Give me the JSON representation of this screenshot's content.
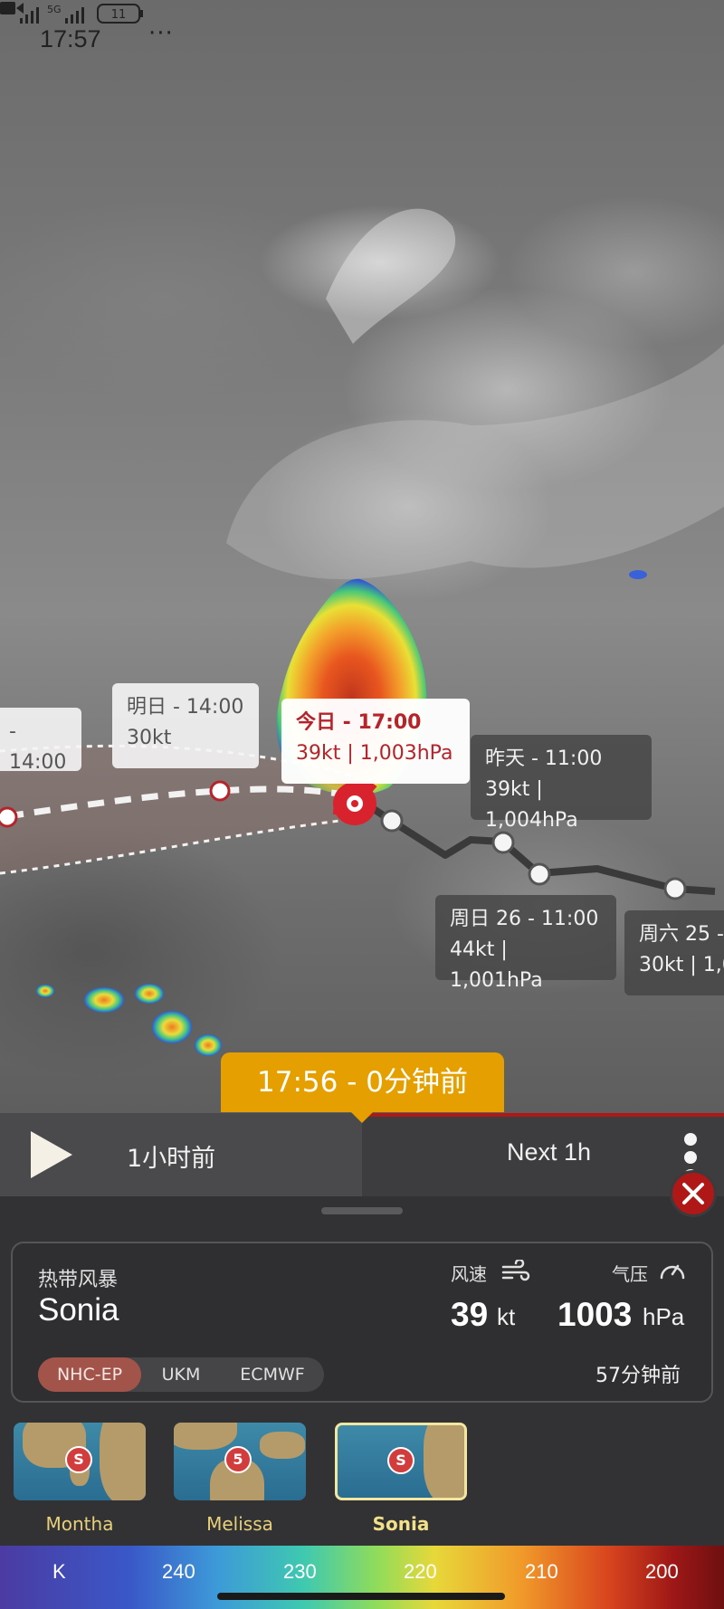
{
  "status_bar": {
    "time": "17:57",
    "dots": "···",
    "battery": "11",
    "network_1": "5G",
    "network_2": "5G"
  },
  "map": {
    "track_labels": {
      "far_left_time": "- 14:00",
      "tomorrow_title": "明日 - 14:00",
      "tomorrow_detail": "30kt",
      "today_title": "今日 - 17:00",
      "today_detail": "39kt | 1,003hPa",
      "yesterday_title": "昨天 - 11:00",
      "yesterday_detail": "39kt | 1,004hPa",
      "sun26_title": "周日 26 - 11:00",
      "sun26_detail": "44kt | 1,001hPa",
      "sat25_title": "周六 25 -",
      "sat25_detail": "30kt | 1,0"
    },
    "timestamp_badge": "17:56 - 0分钟前"
  },
  "timeline": {
    "prev_label": "1小时前",
    "next_label": "Next 1h",
    "accent_color": "#b01717"
  },
  "storm": {
    "type": "热带风暴",
    "name": "Sonia",
    "wind_label": "风速",
    "wind_value": "39",
    "wind_unit": "kt",
    "pressure_label": "气压",
    "pressure_value": "1003",
    "pressure_unit": "hPa",
    "models": [
      "NHC-EP",
      "UKM",
      "ECMWF"
    ],
    "active_model": "NHC-EP",
    "updated": "57分钟前"
  },
  "storm_list": [
    {
      "name": "Montha",
      "badge": "S",
      "active": false
    },
    {
      "name": "Melissa",
      "badge": "5",
      "active": false
    },
    {
      "name": "Sonia",
      "badge": "S",
      "active": true
    }
  ],
  "scale": {
    "unit": "K",
    "ticks": [
      "240",
      "230",
      "220",
      "210",
      "200"
    ]
  },
  "icons": {
    "play": "play-icon",
    "close": "close-icon",
    "menu": "more-vertical-icon",
    "wind": "wind-icon",
    "pressure": "gauge-icon",
    "camera": "video-camera-icon",
    "storm_center": "hurricane-icon"
  }
}
